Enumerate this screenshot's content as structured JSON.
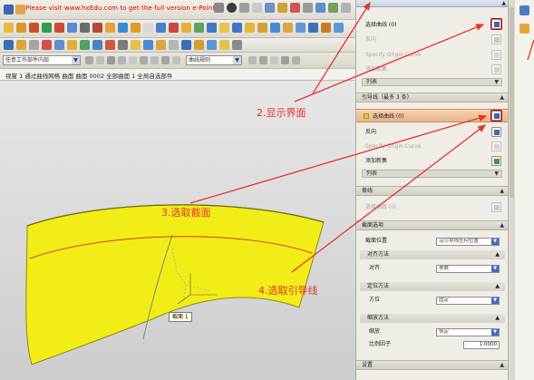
{
  "toolbar": {
    "promo_text": "Please visit www.hxEdu.com to get the full version e-Pointer"
  },
  "selection_bar": {
    "filter_value": "任意工作部件内部",
    "second_combo_value": "曲线规则"
  },
  "breadcrumb": {
    "text": "视窗  1  通过曲线网格  曲面 曲面 0002 全部曲面  1  全局自选部件"
  },
  "viewport": {
    "tooltip": "截面 1"
  },
  "dialog": {
    "section1": {
      "rows": [
        {
          "label": "选择曲线 (0)",
          "state": "enabled"
        },
        {
          "label": "反向",
          "state": "disabled"
        },
        {
          "label": "Specify Origin Curve",
          "state": "disabled"
        },
        {
          "label": "添加新集",
          "state": "disabled"
        }
      ],
      "list_label": "列表"
    },
    "section2": {
      "title": "引导线（最多 3 条）",
      "rows": [
        {
          "label": "选择曲线 (0)",
          "state": "highlighted"
        },
        {
          "label": "反向",
          "state": "enabled"
        },
        {
          "label": "Specify Origin Curve",
          "state": "disabled"
        },
        {
          "label": "添加新集",
          "state": "enabled"
        }
      ],
      "list_label": "列表"
    },
    "section3": {
      "title": "脊线",
      "rows": [
        {
          "label": "选择曲线 (0)",
          "state": "disabled"
        }
      ]
    },
    "section4": {
      "title": "截面选项",
      "position_label": "截面位置",
      "position_value": "沿引导线任何位置",
      "subsections": [
        {
          "title": "对齐方法",
          "field_label": "对齐",
          "field_value": "参数"
        },
        {
          "title": "定位方法",
          "field_label": "方位",
          "field_value": "固定"
        },
        {
          "title": "缩放方法",
          "field_label": "缩放",
          "field_value": "恒定"
        }
      ],
      "scale_label": "比例因子",
      "scale_value": "1.0000"
    },
    "section5": {
      "title": "设置"
    }
  },
  "annotations": {
    "step2": "2.显示界面",
    "step3": "3.选取截面",
    "step4": "4.选取引导线"
  },
  "colors": {
    "surface": "#f2ec17",
    "annotation": "#e5352a",
    "highlight_row": "#f0c49e"
  }
}
